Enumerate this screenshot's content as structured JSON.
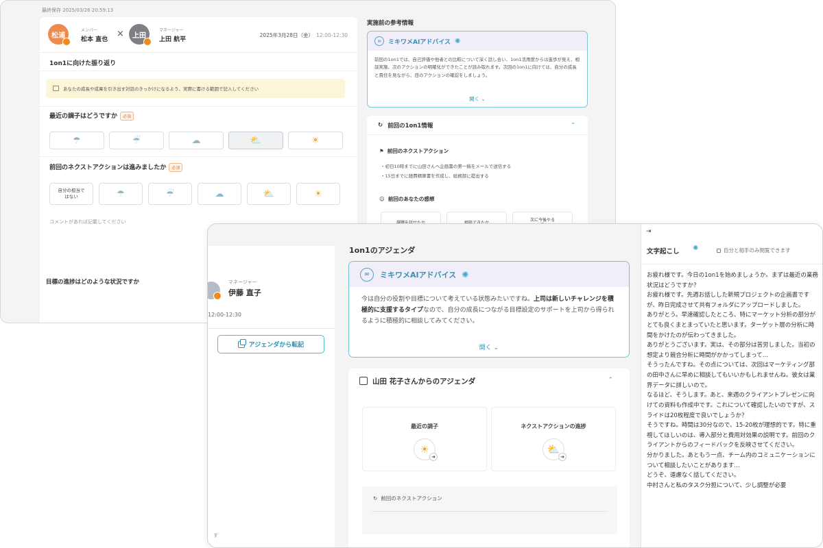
{
  "back": {
    "saved_label": "最終保存 2025/03/26 20:59:13",
    "member": {
      "initial": "松浦",
      "role": "メンバー",
      "name": "松本 直也"
    },
    "times": "×",
    "manager": {
      "initial": "上田",
      "role": "マネージャー",
      "name": "上田 航平"
    },
    "date": "2025年3月28日（金）",
    "time": "12:00-12:30",
    "review_title": "1on1に向けた振り返り",
    "hint": "あなたの成長や成果を引き出す対話のきっかけになるよう、実際に書ける範囲で記入してください",
    "q1": "最近の調子はどうですか",
    "required": "必須",
    "q2": "前回のネクストアクションは進みましたか",
    "na_text": "自分の担当ではない",
    "comment_placeholder": "コメントがあれば記載してください",
    "q3": "目標の進捗はどのような状況ですか",
    "ref_title": "実施前の参考情報",
    "ai_title": "ミキワメAIアドバイス",
    "ai_text": "前回の1on1では、自己評価や他者との比較について深く話し合い、1on1活用度からは進歩が見え、相談実施、次のアクションの明確化ができたことが読み取れます。次回の1on1に向けては、自分の成長と責任を見ながら、目のアクションの確認をしましょう。",
    "open": "開く",
    "prev_info_title": "前回の1on1情報",
    "prev_na_title": "前回のネクストアクション",
    "bullet1": "・初日10時までに山田さんへ企画書の第一稿をメールで送信する",
    "bullet2": "・15日までに経費精算書を作成し、総務部に提出する",
    "prev_feel_title": "前回のあなたの感想",
    "feel1": "課題を話せたか",
    "feel2": "相談できたか",
    "feel3": "次に今後やる\nことが見えたか"
  },
  "front": {
    "manager_role": "マネージャー",
    "manager_name": "伊藤 直子",
    "time": "12:00-12:30",
    "transfer_button": "アジェンダから転記",
    "bottom_left": "す",
    "agenda_title": "1on1のアジェンダ",
    "ai_title": "ミキワメAIアドバイス",
    "ai_text_1": "今は自分の役割や目標について考えている状態みたいですね。",
    "ai_text_bold": "上司は新しいチャレンジを積極的に支援するタイプ",
    "ai_text_2": "なので、自分の成長につながる目標設定のサポートを上司から得られるように積極的に相談してみてください。",
    "open": "開く",
    "from_title": "山田 花子さんからのアジェンダ",
    "stat1": "最近の調子",
    "stat2": "ネクストアクションの進捗",
    "prev_na": "前回のネクストアクション",
    "transcript_title": "文字起こし",
    "privacy": "自分と相手のみ閲覧できます",
    "transcript": [
      "お疲れ様です。今日の1on1を始めましょうか。まずは最近の業務状況はどうですか？",
      "お疲れ様です。先週お話しした新規プロジェクトの企画書ですが、昨日完成させて共有フォルダにアップロードしました。",
      "ありがとう。早速確認したところ、特にマーケット分析の部分がとても良くまとまっていたと思います。ターゲット層の分析に時間をかけたのが伝わってきました。",
      "ありがとうございます。実は、その部分は苦労しました。当初の想定より競合分析に時間がかかってしまって…",
      "そうったんですね。その点については、次回はマーケティング部の田中さんに早めに相談してもいいかもしれませんね。彼女は業界データに詳しいので。",
      "なるほど、そうします。あと、来週のクライアントプレゼンに向けての資料も作成中です。これについて確認したいのですが、スライドは20枚程度で良いでしょうか？",
      "そうですね。時間は30分なので、15-20枚が理想的です。特に重視してほしいのは、導入部分と費用対効果の説明です。前回のクライアントからのフィードバックを反映させてください。",
      "分かりました。あともう一点、チーム内のコミュニケーションについて相談したいことがあります…",
      "どうぞ、遠慮なく話してください。",
      "中村さんと私のタスク分担について、少し調整が必要"
    ]
  }
}
